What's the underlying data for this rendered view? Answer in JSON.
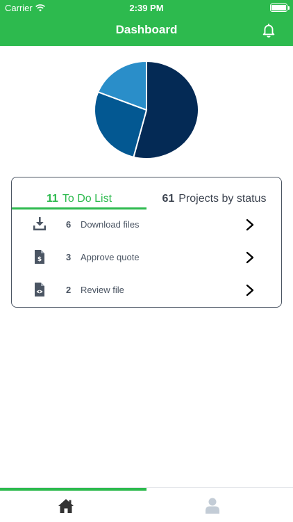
{
  "status_bar": {
    "carrier": "Carrier",
    "time": "2:39 PM"
  },
  "header": {
    "title": "Dashboard",
    "notification_icon": "bell-icon"
  },
  "chart_data": {
    "type": "pie",
    "values": [
      0.54,
      0.27,
      0.19
    ],
    "colors": [
      "#042a55",
      "#035892",
      "#2a8ec9"
    ]
  },
  "tabs": [
    {
      "count": "11",
      "label": "To Do List",
      "active": true
    },
    {
      "count": "61",
      "label": "Projects by status",
      "active": false
    }
  ],
  "todo_items": [
    {
      "icon": "download-icon",
      "count": "6",
      "label": "Download files"
    },
    {
      "icon": "invoice-icon",
      "count": "3",
      "label": "Approve quote"
    },
    {
      "icon": "file-view-icon",
      "count": "2",
      "label": "Review file"
    }
  ],
  "bottom_nav": [
    {
      "icon": "home-icon",
      "active": true
    },
    {
      "icon": "profile-icon",
      "active": false
    }
  ],
  "colors": {
    "accent": "#2dba4e",
    "text": "#4b5563",
    "border": "#4b5563"
  }
}
